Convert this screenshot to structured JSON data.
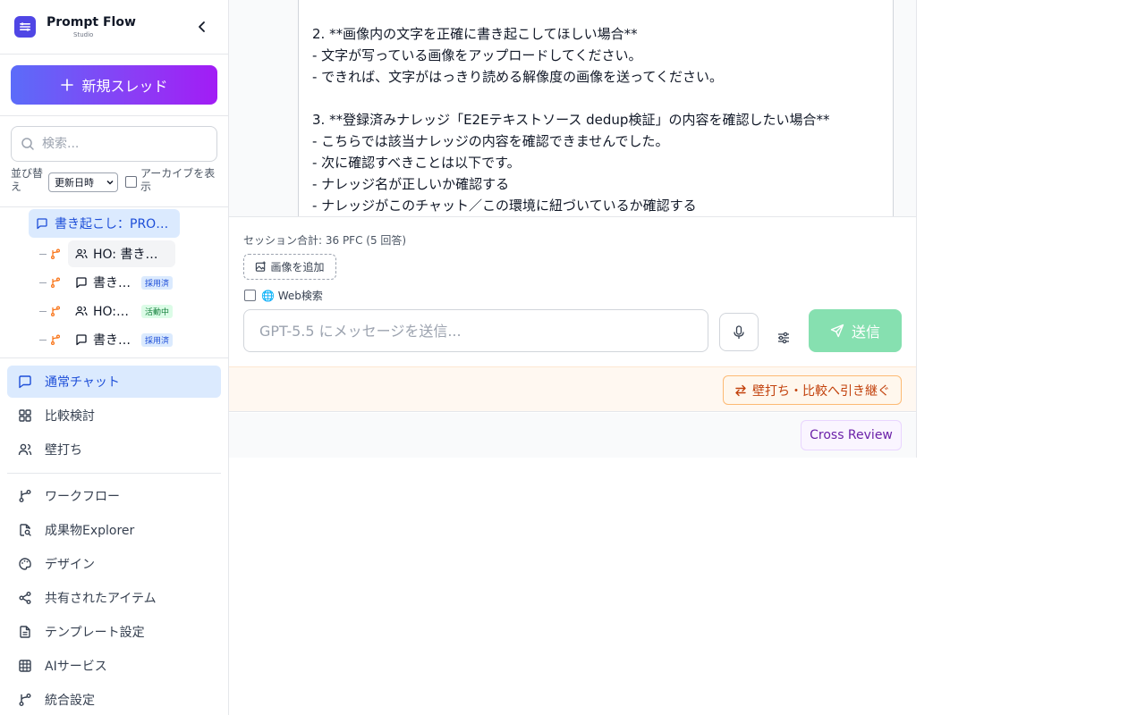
{
  "brand": {
    "title": "Prompt Flow",
    "subtitle": "Studio"
  },
  "sidebar": {
    "new_thread_label": "新規スレッド",
    "search_placeholder": "検索...",
    "sort_label": "並び替え",
    "sort_value": "更新日時",
    "archive_label": "アーカイブを表示",
    "threads": {
      "root": {
        "title": "書き起こし：PROMPT..."
      },
      "children": [
        {
          "title": "HO: 書き起こし",
          "type": "handoff",
          "badge": ""
        },
        {
          "title": "書き起こし",
          "type": "chat",
          "badge": "採用済"
        },
        {
          "title": "HO: 書き起こし",
          "type": "handoff",
          "badge": "活動中"
        },
        {
          "title": "書き起こし",
          "type": "chat",
          "badge": "採用済"
        }
      ]
    },
    "modes": [
      {
        "label": "通常チャット",
        "icon": "chat-icon",
        "active": true
      },
      {
        "label": "比較検討",
        "icon": "grid-icon",
        "active": false
      },
      {
        "label": "壁打ち",
        "icon": "users-icon",
        "active": false
      }
    ],
    "nav": [
      {
        "label": "ワークフロー",
        "icon": "workflow-icon"
      },
      {
        "label": "成果物Explorer",
        "icon": "file-search-icon"
      },
      {
        "label": "デザイン",
        "icon": "palette-icon"
      },
      {
        "label": "共有されたアイテム",
        "icon": "share-icon"
      },
      {
        "label": "テンプレート設定",
        "icon": "document-icon"
      },
      {
        "label": "AIサービス",
        "icon": "table-icon"
      },
      {
        "label": "統合設定",
        "icon": "integration-icon"
      }
    ]
  },
  "chat": {
    "lines": [
      "2. **画像内の文字を正確に書き起こしてほしい場合**",
      "   - 文字が写っている画像をアップロードしてください。",
      "   - できれば、文字がはっきり読める解像度の画像を送ってください。",
      "",
      "3. **登録済みナレッジ「E2Eテキストソース dedup検証」の内容を確認したい場合**",
      "   - こちらでは該当ナレッジの内容を確認できませんでした。",
      "   - 次に確認すべきことは以下です。",
      "     - ナレッジ名が正しいか確認する",
      "     - ナレッジがこのチャット／この環境に紐づいているか確認する"
    ]
  },
  "composer": {
    "session_total": "セッション合計: 36 PFC (5 回答)",
    "add_image_label": "画像を追加",
    "web_search_label": "🌐 Web検索",
    "input_placeholder": "GPT-5.5 にメッセージを送信...",
    "send_label": "送信"
  },
  "handoff": {
    "label": "壁打ち・比較へ引き継ぐ"
  },
  "review": {
    "label": "Cross Review"
  },
  "colors": {
    "accent": "#1d4ed8",
    "send": "#86e0b0",
    "handoff": "#c2410c",
    "review": "#6b21a8"
  }
}
